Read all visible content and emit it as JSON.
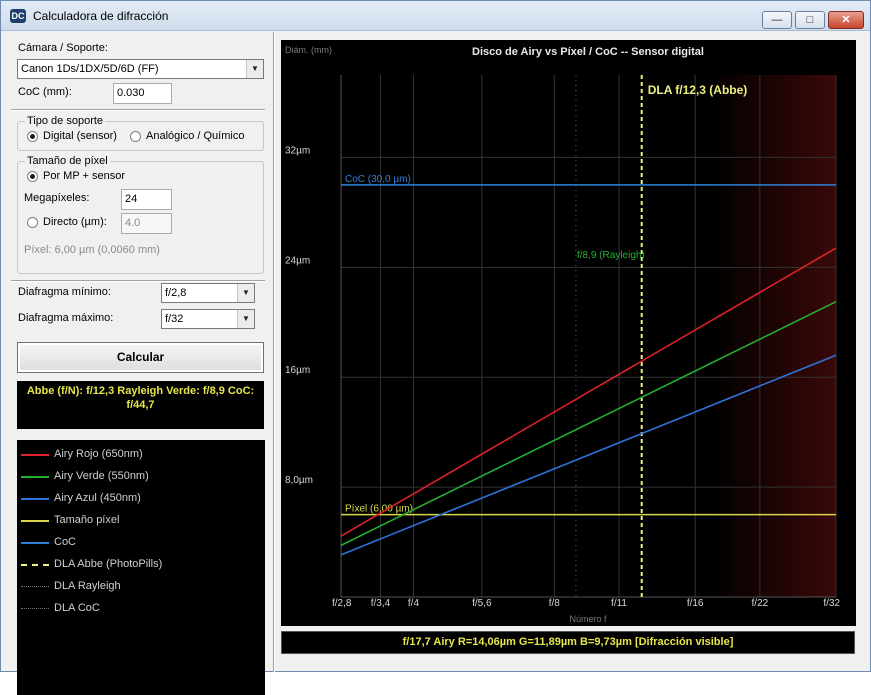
{
  "window": {
    "title": "Calculadora de difracción",
    "icon": "app-logo-icon"
  },
  "controls": {
    "camera_label": "Cámara / Soporte:",
    "camera_value": "Canon 1Ds/1DX/5D/6D (FF)",
    "coc_label": "CoC (mm):",
    "coc_value": "0.030",
    "support_group": "Tipo de soporte",
    "support_digital": "Digital (sensor)",
    "support_analog": "Analógico / Químico",
    "support_selected": "digital",
    "pixel_group": "Tamaño de píxel",
    "pixel_by_mp": "Por MP + sensor",
    "megapixels_label": "Megapíxeles:",
    "megapixels_value": "24",
    "direct_label": "Directo (µm):",
    "direct_value": "4.0",
    "pixel_info": "Píxel: 6,00 µm  (0,0060 mm)",
    "aperture_min_label": "Diafragma mínimo:",
    "aperture_min_value": "f/2,8",
    "aperture_max_label": "Diafragma máximo:",
    "aperture_max_value": "f/32",
    "calc_button": "Calcular"
  },
  "result": {
    "text": "Abbe (f/N): f/12,3   Rayleigh Verde: f/8,9   CoC: f/44,7"
  },
  "legend": [
    {
      "label": "Airy Rojo (650nm)",
      "color": "#e0202a",
      "style": "solid"
    },
    {
      "label": "Airy Verde (550nm)",
      "color": "#22b030",
      "style": "solid"
    },
    {
      "label": "Airy Azul (450nm)",
      "color": "#2f72d8",
      "style": "solid"
    },
    {
      "label": "Tamaño píxel",
      "color": "#d8d84a",
      "style": "solid"
    },
    {
      "label": "CoC",
      "color": "#2f80d8",
      "style": "solid"
    },
    {
      "label": "DLA Abbe (PhotoPills)",
      "color": "#f0f080",
      "style": "dashed"
    },
    {
      "label": "DLA Rayleigh",
      "color": "#707070",
      "style": "dotted"
    },
    {
      "label": "DLA CoC",
      "color": "#707070",
      "style": "dotted"
    }
  ],
  "status": {
    "text": "f/17,7   Airy R=14,06µm  G=11,89µm  B=9,73µm  [Difracción visible]"
  },
  "chart_data": {
    "type": "line",
    "title": "Disco de Airy vs Píxel / CoC  --  Sensor digital",
    "ylabel": "Diám. (mm)",
    "xlabel": "Número f",
    "x_scale": "log",
    "xlim": [
      2.8,
      32
    ],
    "ylim": [
      0,
      38
    ],
    "x_ticks": [
      {
        "value": 2.8,
        "label": "f/2,8"
      },
      {
        "value": 3.4,
        "label": "f/3,4"
      },
      {
        "value": 4,
        "label": "f/4"
      },
      {
        "value": 5.6,
        "label": "f/5,6"
      },
      {
        "value": 8,
        "label": "f/8"
      },
      {
        "value": 11,
        "label": "f/11"
      },
      {
        "value": 16,
        "label": "f/16"
      },
      {
        "value": 22,
        "label": "f/22"
      },
      {
        "value": 32,
        "label": "f/32"
      }
    ],
    "y_ticks": [
      {
        "value": 8,
        "label": "8,0µm"
      },
      {
        "value": 16,
        "label": "16µm"
      },
      {
        "value": 24,
        "label": "24µm"
      },
      {
        "value": 32,
        "label": "32µm"
      }
    ],
    "series": [
      {
        "color": "#e0202a",
        "x": [
          2.8,
          32
        ],
        "y": [
          4.44,
          25.4
        ]
      },
      {
        "color": "#22b030",
        "x": [
          2.8,
          32
        ],
        "y": [
          3.76,
          21.5
        ]
      },
      {
        "color": "#2f72d8",
        "x": [
          2.8,
          32
        ],
        "y": [
          3.07,
          17.6
        ]
      }
    ],
    "hlines": [
      {
        "value": 6.0,
        "label": "Píxel (6,00 µm)",
        "color": "#d8d84a"
      },
      {
        "value": 30.0,
        "label": "CoC (30,0 µm)",
        "color": "#2f80d8"
      }
    ],
    "vlines": [
      {
        "value": 12.3,
        "label": "DLA f/12,3 (Abbe)",
        "color": "#f0f080",
        "style": "dashed"
      },
      {
        "value": 8.9,
        "label": "f/8,9 (Rayleigh)",
        "color": "#22b030",
        "style": "dotted"
      }
    ],
    "grid": true
  }
}
